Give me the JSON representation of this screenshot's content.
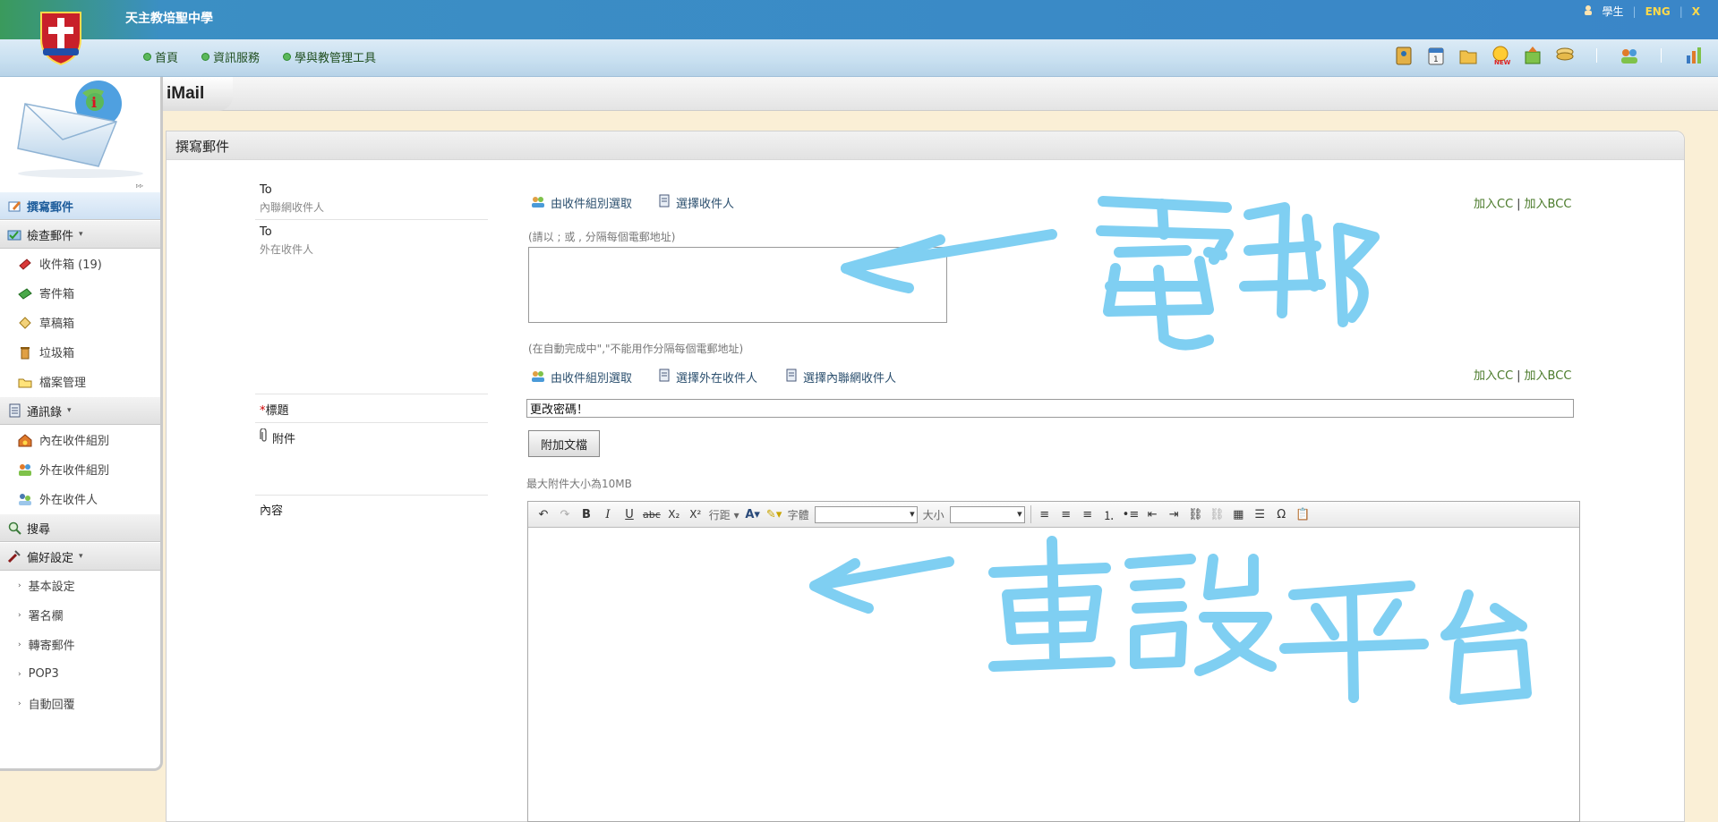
{
  "header": {
    "school_name": "天主教培聖中學",
    "user_label": "學生",
    "lang_label": "ENG",
    "close_label": "X",
    "nav": [
      "首頁",
      "資訊服務",
      "學與教管理工具"
    ],
    "tool_icons": [
      "contacts-icon",
      "calendar-icon",
      "folder-icon",
      "new-icon",
      "upload-icon",
      "stack-icon",
      "group-icon",
      "chart-icon"
    ]
  },
  "app_title": "iMail",
  "sidebar": {
    "compose": "撰寫郵件",
    "check_mail": "檢查郵件",
    "inbox": "收件箱 (19)",
    "sent": "寄件箱",
    "drafts": "草稿箱",
    "trash": "垃圾箱",
    "files": "檔案管理",
    "address_book": "通訊錄",
    "internal_groups": "內在收件組別",
    "external_groups": "外在收件組別",
    "external_recipients": "外在收件人",
    "search": "搜尋",
    "preferences": "偏好設定",
    "basic_settings": "基本設定",
    "signature": "署名欄",
    "forwarding": "轉寄郵件",
    "pop3": "POP3",
    "auto_reply": "自動回覆"
  },
  "compose": {
    "panel_title": "撰寫郵件",
    "to_label": "To",
    "to_internal_sub": "內聯網收件人",
    "to_external_sub": "外在收件人",
    "from_group_select": "由收件組別選取",
    "select_recipient": "選擇收件人",
    "add_cc": "加入CC",
    "add_bcc": "加入BCC",
    "cc_separator": "|",
    "email_hint": "(請以 ; 或 , 分隔每個電郵地址)",
    "autocomplete_hint": "(在自動完成中\",\"不能用作分隔每個電郵地址)",
    "select_external": "選擇外在收件人",
    "select_internal": "選擇內聯網收件人",
    "subject_label": "標題",
    "subject_required": "*",
    "subject_value": "更改密碼！",
    "attachment_label": "附件",
    "attach_button": "附加文檔",
    "attachment_limit": "最大附件大小為10MB",
    "content_label": "內容"
  },
  "editor_toolbar": {
    "line_spacing": "行距",
    "font_label": "字體",
    "size_label": "大小",
    "bold": "B",
    "italic": "I",
    "underline": "U",
    "strike": "abc",
    "subscript": "X₂",
    "superscript": "X²",
    "special_char": "Ω"
  },
  "annotations": {
    "arrow_email": "←一電郵",
    "arrow_reset": "←重設平台",
    "color": "#7fcff2"
  }
}
